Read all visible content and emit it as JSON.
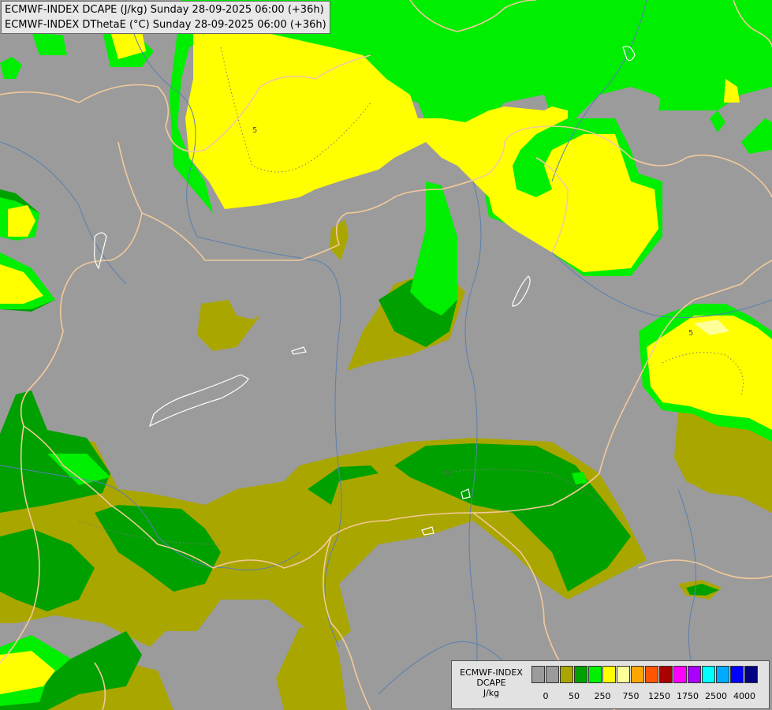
{
  "header": {
    "line1": "ECMWF-INDEX DCAPE (J/kg) Sunday 28-09-2025 06:00 (+36h)",
    "line2": "ECMWF-INDEX DThetaE (°C) Sunday 28-09-2025 06:00 (+36h)"
  },
  "map": {
    "background_color": "#9b9b9b",
    "border_color": "#f3c99a",
    "river_color": "#5a7fb0",
    "lake_outline_color": "#ffffff",
    "contour_labels": [
      "5",
      "5",
      "5"
    ]
  },
  "legend": {
    "title_lines": [
      "ECMWF-INDEX",
      "DCAPE",
      "J/kg"
    ],
    "colors": [
      "#9b9b9b",
      "#9b9b9b",
      "#aaa600",
      "#00a000",
      "#00ee00",
      "#ffff00",
      "#ffff99",
      "#ffa500",
      "#ff5500",
      "#aa0000",
      "#ff00ff",
      "#aa00ff",
      "#00ffff",
      "#00aaff",
      "#0000ff",
      "#000080"
    ],
    "tick_labels": [
      "0",
      "50",
      "250",
      "750",
      "1250",
      "1750",
      "2500",
      "4000"
    ]
  }
}
